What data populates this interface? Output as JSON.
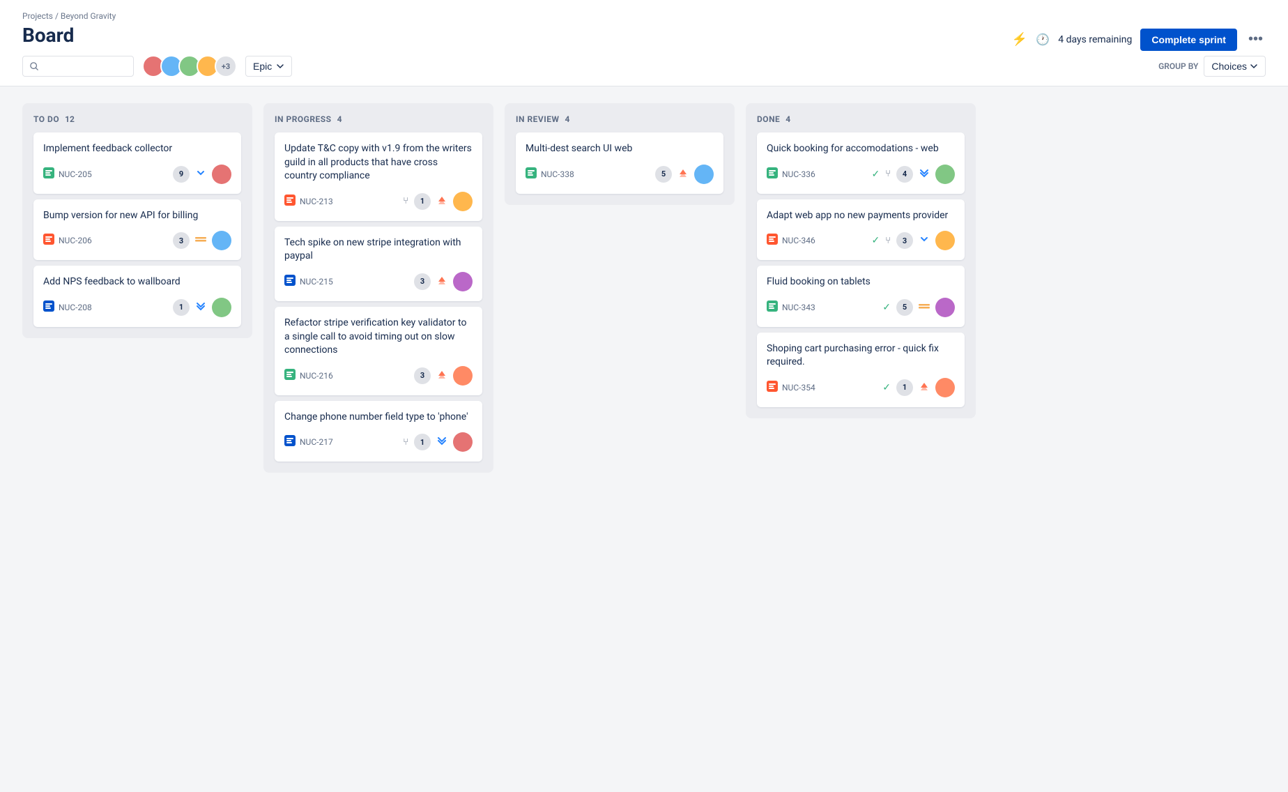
{
  "breadcrumb": "Projects / Beyond Gravity",
  "page_title": "Board",
  "header": {
    "timer_label": "4 days remaining",
    "complete_sprint_label": "Complete sprint",
    "more_icon": "•••",
    "group_by_label": "GROUP BY",
    "choices_label": "Choices",
    "epic_label": "Epic",
    "search_placeholder": "Search",
    "avatar_extra": "+3"
  },
  "columns": [
    {
      "id": "todo",
      "title": "TO DO",
      "count": 12,
      "cards": [
        {
          "id": "c1",
          "title": "Implement feedback collector",
          "ticket_id": "NUC-205",
          "ticket_color": "green",
          "badge": "9",
          "priority": "down",
          "avatar_color": "av1"
        },
        {
          "id": "c2",
          "title": "Bump version for new API for billing",
          "ticket_id": "NUC-206",
          "ticket_color": "red",
          "badge": "3",
          "priority": "medium",
          "avatar_color": "av2"
        },
        {
          "id": "c3",
          "title": "Add NPS feedback to wallboard",
          "ticket_id": "NUC-208",
          "ticket_color": "blue",
          "badge": "1",
          "priority": "lowest",
          "avatar_color": "av3"
        }
      ]
    },
    {
      "id": "inprogress",
      "title": "IN PROGRESS",
      "count": 4,
      "cards": [
        {
          "id": "c4",
          "title": "Update T&C copy with v1.9 from the writers guild in all products that have cross country compliance",
          "ticket_id": "NUC-213",
          "ticket_color": "red",
          "badge": "1",
          "priority": "high",
          "avatar_color": "av4",
          "branch": true
        },
        {
          "id": "c5",
          "title": "Tech spike on new stripe integration with paypal",
          "ticket_id": "NUC-215",
          "ticket_color": "blue",
          "badge": "3",
          "priority": "high",
          "avatar_color": "av5"
        },
        {
          "id": "c6",
          "title": "Refactor stripe verification key validator to a single call to avoid timing out on slow connections",
          "ticket_id": "NUC-216",
          "ticket_color": "green",
          "badge": "3",
          "priority": "high",
          "avatar_color": "av6"
        },
        {
          "id": "c7",
          "title": "Change phone number field type to 'phone'",
          "ticket_id": "NUC-217",
          "ticket_color": "blue",
          "badge": "1",
          "priority": "lowest",
          "avatar_color": "av1",
          "branch": true
        }
      ]
    },
    {
      "id": "inreview",
      "title": "IN REVIEW",
      "count": 4,
      "cards": [
        {
          "id": "c8",
          "title": "Multi-dest search UI web",
          "ticket_id": "NUC-338",
          "ticket_color": "green",
          "badge": "5",
          "priority": "high_up",
          "avatar_color": "av2"
        }
      ]
    },
    {
      "id": "done",
      "title": "DONE",
      "count": 4,
      "cards": [
        {
          "id": "c9",
          "title": "Quick booking for accomodations - web",
          "ticket_id": "NUC-336",
          "ticket_color": "green",
          "badge": "4",
          "priority": "lowest",
          "avatar_color": "av3",
          "check": true,
          "branch": true
        },
        {
          "id": "c10",
          "title": "Adapt web app no new payments provider",
          "ticket_id": "NUC-346",
          "ticket_color": "red",
          "badge": "3",
          "priority": "down",
          "avatar_color": "av4",
          "check": true,
          "branch": true
        },
        {
          "id": "c11",
          "title": "Fluid booking on tablets",
          "ticket_id": "NUC-343",
          "ticket_color": "green",
          "badge": "5",
          "priority": "medium",
          "avatar_color": "av5",
          "check": true
        },
        {
          "id": "c12",
          "title": "Shoping cart purchasing error - quick fix required.",
          "ticket_id": "NUC-354",
          "ticket_color": "red",
          "badge": "1",
          "priority": "high",
          "avatar_color": "av6",
          "check": true
        }
      ]
    }
  ]
}
